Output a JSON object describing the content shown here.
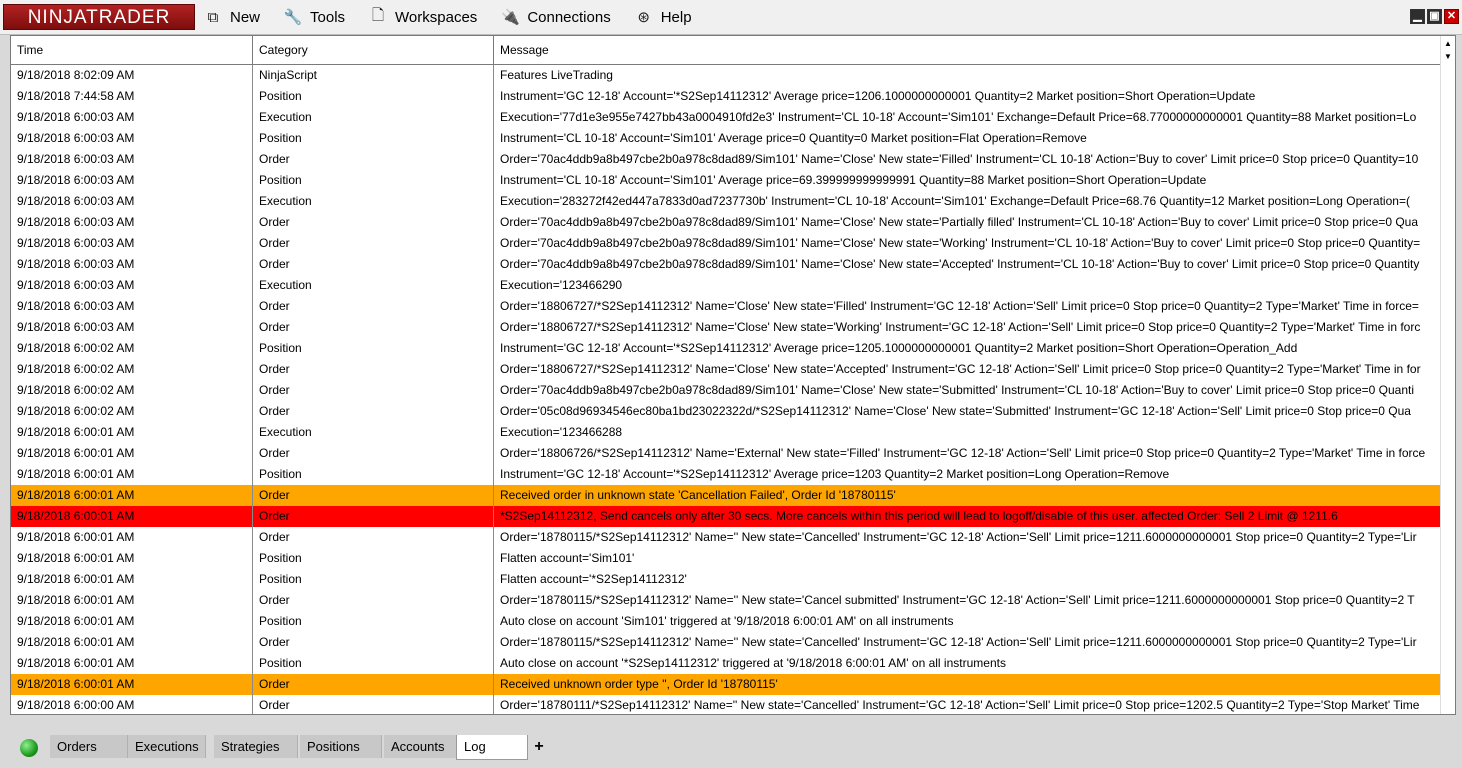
{
  "app": {
    "logo_text": "NINJATRADER"
  },
  "menu": [
    {
      "label": "New",
      "icon": "new-window-icon",
      "glyph": "⧉"
    },
    {
      "label": "Tools",
      "icon": "wrench-icon",
      "glyph": "🔧"
    },
    {
      "label": "Workspaces",
      "icon": "document-icon",
      "glyph": "🗋"
    },
    {
      "label": "Connections",
      "icon": "plug-icon",
      "glyph": "🔌"
    },
    {
      "label": "Help",
      "icon": "lifebuoy-icon",
      "glyph": "⊛"
    }
  ],
  "window_controls": {
    "minimize": "▁",
    "maximize": "▣",
    "close": "✕"
  },
  "grid": {
    "headers": {
      "time": "Time",
      "category": "Category",
      "message": "Message"
    },
    "rows": [
      {
        "time": "9/18/2018 8:02:09 AM",
        "category": "NinjaScript",
        "message": "Features LiveTrading"
      },
      {
        "time": "9/18/2018 7:44:58 AM",
        "category": "Position",
        "message": "Instrument='GC 12-18' Account='*S2Sep14112312' Average price=1206.1000000000001 Quantity=2 Market position=Short Operation=Update"
      },
      {
        "time": "9/18/2018 6:00:03 AM",
        "category": "Execution",
        "message": "Execution='77d1e3e955e7427bb43a0004910fd2e3' Instrument='CL 10-18' Account='Sim101' Exchange=Default Price=68.77000000000001 Quantity=88 Market position=Lo"
      },
      {
        "time": "9/18/2018 6:00:03 AM",
        "category": "Position",
        "message": "Instrument='CL 10-18' Account='Sim101' Average price=0 Quantity=0 Market position=Flat Operation=Remove"
      },
      {
        "time": "9/18/2018 6:00:03 AM",
        "category": "Order",
        "message": "Order='70ac4ddb9a8b497cbe2b0a978c8dad89/Sim101' Name='Close' New state='Filled' Instrument='CL 10-18' Action='Buy to cover' Limit price=0 Stop price=0 Quantity=10"
      },
      {
        "time": "9/18/2018 6:00:03 AM",
        "category": "Position",
        "message": "Instrument='CL 10-18' Account='Sim101' Average price=69.399999999999991 Quantity=88 Market position=Short Operation=Update"
      },
      {
        "time": "9/18/2018 6:00:03 AM",
        "category": "Execution",
        "message": "Execution='283272f42ed447a7833d0ad7237730b' Instrument='CL 10-18' Account='Sim101' Exchange=Default Price=68.76 Quantity=12 Market position=Long Operation=("
      },
      {
        "time": "9/18/2018 6:00:03 AM",
        "category": "Order",
        "message": "Order='70ac4ddb9a8b497cbe2b0a978c8dad89/Sim101' Name='Close' New state='Partially filled' Instrument='CL 10-18' Action='Buy to cover' Limit price=0 Stop price=0 Qua"
      },
      {
        "time": "9/18/2018 6:00:03 AM",
        "category": "Order",
        "message": "Order='70ac4ddb9a8b497cbe2b0a978c8dad89/Sim101' Name='Close' New state='Working' Instrument='CL 10-18' Action='Buy to cover' Limit price=0 Stop price=0 Quantity="
      },
      {
        "time": "9/18/2018 6:00:03 AM",
        "category": "Order",
        "message": "Order='70ac4ddb9a8b497cbe2b0a978c8dad89/Sim101' Name='Close' New state='Accepted' Instrument='CL 10-18' Action='Buy to cover' Limit price=0 Stop price=0 Quantity"
      },
      {
        "time": "9/18/2018 6:00:03 AM",
        "category": "Execution",
        "message": "Execution='123466290"
      },
      {
        "time": "9/18/2018 6:00:03 AM",
        "category": "Order",
        "message": "Order='18806727/*S2Sep14112312' Name='Close' New state='Filled' Instrument='GC 12-18' Action='Sell' Limit price=0 Stop price=0 Quantity=2 Type='Market' Time in force="
      },
      {
        "time": "9/18/2018 6:00:03 AM",
        "category": "Order",
        "message": "Order='18806727/*S2Sep14112312' Name='Close' New state='Working' Instrument='GC 12-18' Action='Sell' Limit price=0 Stop price=0 Quantity=2 Type='Market' Time in forc"
      },
      {
        "time": "9/18/2018 6:00:02 AM",
        "category": "Position",
        "message": "Instrument='GC 12-18' Account='*S2Sep14112312' Average price=1205.1000000000001 Quantity=2 Market position=Short Operation=Operation_Add"
      },
      {
        "time": "9/18/2018 6:00:02 AM",
        "category": "Order",
        "message": "Order='18806727/*S2Sep14112312' Name='Close' New state='Accepted' Instrument='GC 12-18' Action='Sell' Limit price=0 Stop price=0 Quantity=2 Type='Market' Time in for"
      },
      {
        "time": "9/18/2018 6:00:02 AM",
        "category": "Order",
        "message": "Order='70ac4ddb9a8b497cbe2b0a978c8dad89/Sim101' Name='Close' New state='Submitted' Instrument='CL 10-18' Action='Buy to cover' Limit price=0 Stop price=0 Quanti"
      },
      {
        "time": "9/18/2018 6:00:02 AM",
        "category": "Order",
        "message": "Order='05c08d96934546ec80ba1bd23022322d/*S2Sep14112312' Name='Close' New state='Submitted' Instrument='GC 12-18' Action='Sell' Limit price=0 Stop price=0 Qua"
      },
      {
        "time": "9/18/2018 6:00:01 AM",
        "category": "Execution",
        "message": "Execution='123466288"
      },
      {
        "time": "9/18/2018 6:00:01 AM",
        "category": "Order",
        "message": "Order='18806726/*S2Sep14112312' Name='External' New state='Filled' Instrument='GC 12-18' Action='Sell' Limit price=0 Stop price=0 Quantity=2 Type='Market' Time in force"
      },
      {
        "time": "9/18/2018 6:00:01 AM",
        "category": "Position",
        "message": "Instrument='GC 12-18' Account='*S2Sep14112312' Average price=1203 Quantity=2 Market position=Long Operation=Remove"
      },
      {
        "time": "9/18/2018 6:00:01 AM",
        "category": "Order",
        "message": "Received order in unknown state 'Cancellation Failed', Order Id '18780115'",
        "level": "warn"
      },
      {
        "time": "9/18/2018 6:00:01 AM",
        "category": "Order",
        "message": "*S2Sep14112312, Send cancels only after 30 secs. More cancels within this period will lead to logoff/disable of this user. affected Order: Sell 2 Limit @ 1211.6",
        "level": "err"
      },
      {
        "time": "9/18/2018 6:00:01 AM",
        "category": "Order",
        "message": "Order='18780115/*S2Sep14112312' Name='' New state='Cancelled' Instrument='GC 12-18' Action='Sell' Limit price=1211.6000000000001 Stop price=0 Quantity=2 Type='Lir"
      },
      {
        "time": "9/18/2018 6:00:01 AM",
        "category": "Position",
        "message": "Flatten account='Sim101'"
      },
      {
        "time": "9/18/2018 6:00:01 AM",
        "category": "Position",
        "message": "Flatten account='*S2Sep14112312'"
      },
      {
        "time": "9/18/2018 6:00:01 AM",
        "category": "Order",
        "message": "Order='18780115/*S2Sep14112312' Name='' New state='Cancel submitted' Instrument='GC 12-18' Action='Sell' Limit price=1211.6000000000001 Stop price=0 Quantity=2 T"
      },
      {
        "time": "9/18/2018 6:00:01 AM",
        "category": "Position",
        "message": "Auto close on account 'Sim101' triggered at '9/18/2018 6:00:01 AM' on all instruments"
      },
      {
        "time": "9/18/2018 6:00:01 AM",
        "category": "Order",
        "message": "Order='18780115/*S2Sep14112312' Name='' New state='Cancelled' Instrument='GC 12-18' Action='Sell' Limit price=1211.6000000000001 Stop price=0 Quantity=2 Type='Lir"
      },
      {
        "time": "9/18/2018 6:00:01 AM",
        "category": "Position",
        "message": "Auto close on account '*S2Sep14112312' triggered at '9/18/2018 6:00:01 AM' on all instruments"
      },
      {
        "time": "9/18/2018 6:00:01 AM",
        "category": "Order",
        "message": "Received unknown order type '', Order Id '18780115'",
        "level": "warn"
      },
      {
        "time": "9/18/2018 6:00:00 AM",
        "category": "Order",
        "message": "Order='18780111/*S2Sep14112312' Name='' New state='Cancelled' Instrument='GC 12-18' Action='Sell' Limit price=0 Stop price=1202.5 Quantity=2 Type='Stop Market' Time"
      }
    ]
  },
  "tabs": [
    {
      "label": "Orders"
    },
    {
      "label": "Executions"
    },
    {
      "label": "Strategies"
    },
    {
      "label": "Positions"
    },
    {
      "label": "Accounts"
    },
    {
      "label": "Log",
      "active": true
    }
  ],
  "add_tab_label": "+",
  "scroll": {
    "up": "▲",
    "down": "▼"
  },
  "colors": {
    "warning_row": "#ffa500",
    "error_row": "#ff0000",
    "connection_status": "#1e9a1e"
  }
}
